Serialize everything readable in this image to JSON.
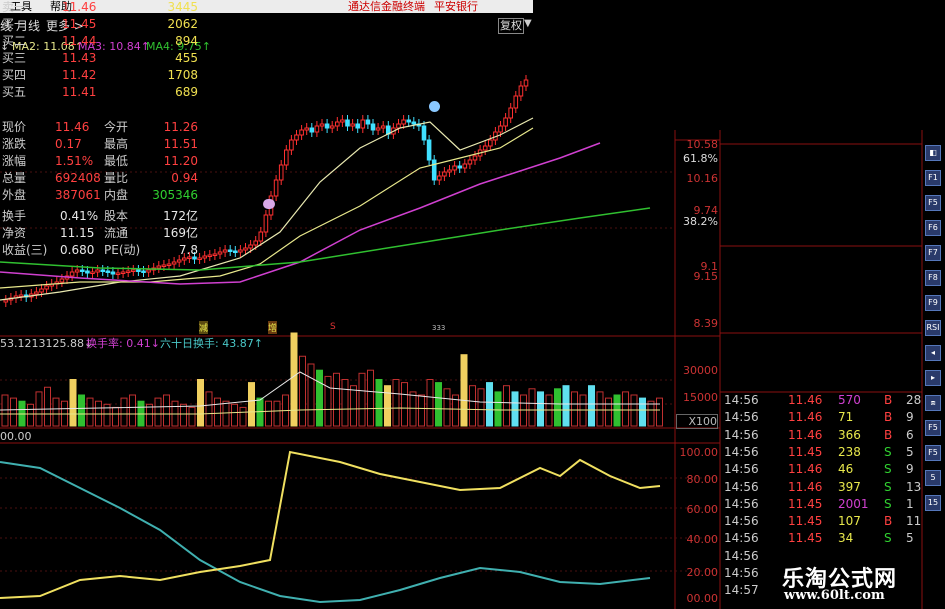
{
  "menu": {
    "tools": "工具",
    "help": "帮助",
    "promo1": "通达信金融终端",
    "promo2": "平安银行"
  },
  "toolbar": {
    "item1": "线",
    "monthly": "月线",
    "more": "更多 >",
    "fuquan": "复权"
  },
  "ma_legend": [
    {
      "label": "↓",
      "color": "#cccccc"
    },
    {
      "label": "MA2: 11.08↑",
      "color": "#e8e88c"
    },
    {
      "label": "MA3: 10.84↑",
      "color": "#d040d0"
    },
    {
      "label": "MA4: 9.75↑",
      "color": "#30c030"
    }
  ],
  "price_axis": [
    "10.58",
    "61.8%",
    "10.16",
    "9.74",
    "38.2%",
    "9.1",
    "9.15",
    "8.39"
  ],
  "vol_legend": {
    "v1": "53.1213125.88↓",
    "v2": "换手率: 0.41↓",
    "v3": "六十日换手: 43.87↑"
  },
  "vol_axis": [
    "30000",
    "15000",
    "X100"
  ],
  "indicator_label": "00.00",
  "ind_axis": [
    "100.00",
    "80.00",
    "60.00",
    "40.00",
    "20.00",
    "00.00"
  ],
  "markers": {
    "m1": "减",
    "m2": "增",
    "m3": "S",
    "m4": "333"
  },
  "order_book": [
    {
      "label": "卖一",
      "price": "11.46",
      "vol": "3445"
    },
    {
      "label": "买一",
      "price": "11.45",
      "vol": "2062"
    },
    {
      "label": "买二",
      "price": "11.44",
      "vol": "894"
    },
    {
      "label": "买三",
      "price": "11.43",
      "vol": "455"
    },
    {
      "label": "买四",
      "price": "11.42",
      "vol": "1708"
    },
    {
      "label": "买五",
      "price": "11.41",
      "vol": "689"
    }
  ],
  "stats": [
    {
      "l1": "现价",
      "v1": "11.46",
      "l2": "今开",
      "v2": "11.26"
    },
    {
      "l1": "涨跌",
      "v1": "0.17",
      "l2": "最高",
      "v2": "11.51"
    },
    {
      "l1": "涨幅",
      "v1": "1.51%",
      "l2": "最低",
      "v2": "11.20"
    },
    {
      "l1": "总量",
      "v1": "692408",
      "l2": "量比",
      "v2": "0.94"
    },
    {
      "l1": "外盘",
      "v1": "387061",
      "l2": "内盘",
      "v2": "305346"
    }
  ],
  "stats2": [
    {
      "l1": "换手",
      "v1": "0.41%",
      "l2": "股本",
      "v2": "172亿"
    },
    {
      "l1": "净资",
      "v1": "11.15",
      "l2": "流通",
      "v2": "169亿"
    },
    {
      "l1": "收益(三)",
      "v1": "0.680",
      "l2": "PE(动)",
      "v2": "7.8"
    }
  ],
  "ticks": [
    {
      "t": "14:56",
      "p": "11.46",
      "v": "570",
      "s": "B",
      "n": "28",
      "vc": "#d040d0"
    },
    {
      "t": "14:56",
      "p": "11.46",
      "v": "71",
      "s": "B",
      "n": "9",
      "vc": "#e8e84c"
    },
    {
      "t": "14:56",
      "p": "11.46",
      "v": "366",
      "s": "B",
      "n": "6",
      "vc": "#e8e84c"
    },
    {
      "t": "14:56",
      "p": "11.45",
      "v": "238",
      "s": "S",
      "n": "5",
      "vc": "#e8e84c"
    },
    {
      "t": "14:56",
      "p": "11.46",
      "v": "46",
      "s": "S",
      "n": "9",
      "vc": "#e8e84c"
    },
    {
      "t": "14:56",
      "p": "11.46",
      "v": "397",
      "s": "S",
      "n": "13",
      "vc": "#e8e84c"
    },
    {
      "t": "14:56",
      "p": "11.45",
      "v": "2001",
      "s": "S",
      "n": "1",
      "vc": "#d040d0"
    },
    {
      "t": "14:56",
      "p": "11.45",
      "v": "107",
      "s": "B",
      "n": "11",
      "vc": "#e8e84c"
    },
    {
      "t": "14:56",
      "p": "11.45",
      "v": "34",
      "s": "S",
      "n": "5",
      "vc": "#e8e84c"
    },
    {
      "t": "14:56",
      "p": "",
      "v": "",
      "s": "",
      "n": "",
      "vc": "#e8e84c"
    },
    {
      "t": "14:56",
      "p": "",
      "v": "",
      "s": "",
      "n": "",
      "vc": "#e8e84c"
    },
    {
      "t": "14:57",
      "p": "",
      "v": "",
      "s": "",
      "n": "",
      "vc": "#e8e84c"
    }
  ],
  "sidebar_buttons": [
    "◧",
    "F1",
    "F5",
    "F6",
    "F7",
    "F8",
    "F9",
    "RSI",
    "◂",
    "▸",
    "⧈",
    "F5",
    "F5",
    "5",
    "15"
  ],
  "watermark": {
    "title": "乐淘公式网",
    "url": "www.60lt.com"
  }
}
